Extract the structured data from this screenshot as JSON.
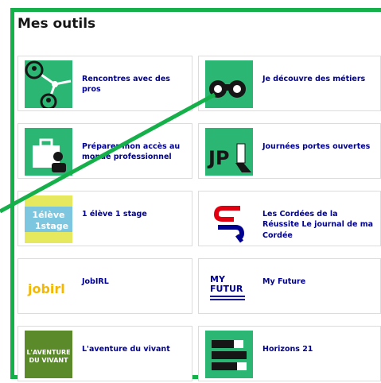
{
  "page": {
    "title": "Mes outils"
  },
  "tools": [
    {
      "label": "Rencontres avec des pros",
      "icon": "rencontres-pros-icon"
    },
    {
      "label": "Je découvre des métiers",
      "icon": "binoculars-icon"
    },
    {
      "label": "Préparer mon accès au monde professionnel",
      "icon": "briefcase-icon"
    },
    {
      "label": "Journées portes ouvertes",
      "icon": "jpo-icon"
    },
    {
      "label": "1 élève 1 stage",
      "icon": "1eleve1stage-logo",
      "logo_text": "1élève 1stage"
    },
    {
      "label": "Les Cordées de la Réussite Le journal de ma Cordée",
      "icon": "cordees-logo"
    },
    {
      "label": "JobIRL",
      "icon": "jobirl-logo",
      "logo_text": "jobirl"
    },
    {
      "label": "My Future",
      "icon": "my-future-logo",
      "logo_text": "MY FUTUR"
    },
    {
      "label": "L'aventure du vivant",
      "icon": "aventure-vivant-logo",
      "logo_text": "L'AVENTURE DU VIVANT"
    },
    {
      "label": "Horizons 21",
      "icon": "horizons21-icon"
    }
  ],
  "colors": {
    "accent_green": "#16b04b",
    "tile_green": "#2bb673",
    "link_blue": "#000091"
  }
}
